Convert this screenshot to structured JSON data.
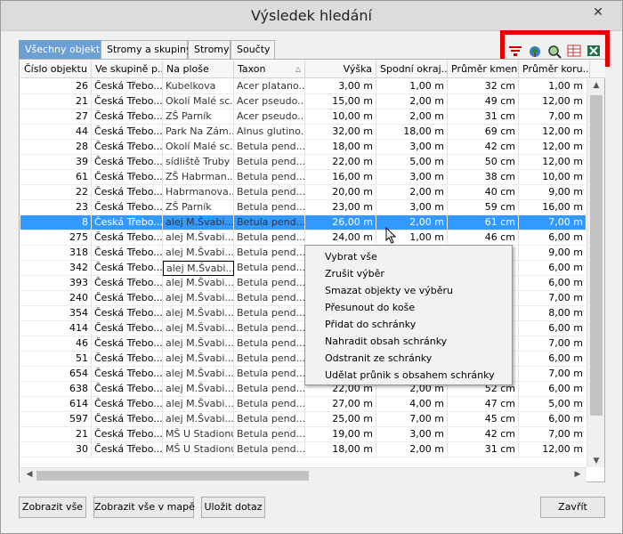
{
  "window": {
    "title": "Výsledek hledání",
    "close_label": "✕"
  },
  "tabs": [
    {
      "label": "Všechny objekty",
      "active": true
    },
    {
      "label": "Stromy a skupiny"
    },
    {
      "label": "Stromy"
    },
    {
      "label": "Součty"
    }
  ],
  "toolbar": {
    "icons": [
      "filter-icon",
      "map-tree-icon",
      "zoom-map-icon",
      "table-icon",
      "excel-icon"
    ],
    "accent_frame_color": "#e60000"
  },
  "columns": [
    "Číslo objektu",
    "Ve skupině p...",
    "Na ploše",
    "Taxon",
    "Výška",
    "Spodní okraj...",
    "Průměr kmene",
    "Průměr koru..."
  ],
  "rows": [
    [
      "26",
      "Česká Třebo...",
      "Kubelkova",
      "Acer platano...",
      "3,00 m",
      "1,00 m",
      "32 cm",
      "1,00 m"
    ],
    [
      "21",
      "Česká Třebo...",
      "Okolí Malé sc...",
      "Acer pseudo...",
      "15,00 m",
      "2,00 m",
      "49 cm",
      "12,00 m"
    ],
    [
      "27",
      "Česká Třebo...",
      "ZŠ Parník",
      "Acer pseudo...",
      "10,00 m",
      "2,00 m",
      "31 cm",
      "7,00 m"
    ],
    [
      "44",
      "Česká Třebo...",
      "Park Na Zám...",
      "Alnus glutino...",
      "32,00 m",
      "18,00 m",
      "69 cm",
      "12,00 m"
    ],
    [
      "28",
      "Česká Třebo...",
      "Okolí Malé sc...",
      "Betula pend...",
      "18,00 m",
      "3,00 m",
      "42 cm",
      "12,00 m"
    ],
    [
      "39",
      "Česká Třebo...",
      "sídliště Truby",
      "Betula pend...",
      "22,00 m",
      "5,00 m",
      "50 cm",
      "12,00 m"
    ],
    [
      "61",
      "Česká Třebo...",
      "ZŠ Habrman...",
      "Betula pend...",
      "16,00 m",
      "3,00 m",
      "38 cm",
      "10,00 m"
    ],
    [
      "22",
      "Česká Třebo...",
      "Habrmanova...",
      "Betula pend...",
      "20,00 m",
      "2,00 m",
      "40 cm",
      "9,00 m"
    ],
    [
      "23",
      "Česká Třebo...",
      "ZŠ Parník",
      "Betula pend...",
      "23,00 m",
      "3,00 m",
      "59 cm",
      "16,00 m"
    ],
    [
      "8",
      "Česká Třebo...",
      "alej M.Švabi...",
      "Betula pend...",
      "26,00 m",
      "2,00 m",
      "61 cm",
      "7,00 m"
    ],
    [
      "275",
      "Česká Třebo...",
      "alej M.Švabi...",
      "Betula pend...",
      "24,00 m",
      "1,00 m",
      "46 cm",
      "6,00 m"
    ],
    [
      "318",
      "Česká Třebo...",
      "alej M.Švabi...",
      "Betula pend...",
      "",
      "",
      "",
      "9,00 m"
    ],
    [
      "342",
      "Česká Třebo...",
      "alej M.Švabi...",
      "Betula pend...",
      "",
      "",
      "",
      "6,00 m"
    ],
    [
      "393",
      "Česká Třebo...",
      "alej M.Švabi...",
      "Betula pend...",
      "",
      "",
      "",
      "6,00 m"
    ],
    [
      "240",
      "Česká Třebo...",
      "alej M.Švabi...",
      "Betula pend...",
      "",
      "",
      "",
      "7,00 m"
    ],
    [
      "354",
      "Česká Třebo...",
      "alej M.Švabi...",
      "Betula pend...",
      "",
      "",
      "",
      "8,00 m"
    ],
    [
      "414",
      "Česká Třebo...",
      "alej M.Švabi...",
      "Betula pend...",
      "",
      "",
      "",
      "6,00 m"
    ],
    [
      "46",
      "Česká Třebo...",
      "alej M.Švabi...",
      "Betula pend...",
      "",
      "",
      "",
      "7,00 m"
    ],
    [
      "51",
      "Česká Třebo...",
      "alej M.Švabi...",
      "Betula pend...",
      "",
      "",
      "",
      "6,00 m"
    ],
    [
      "654",
      "Česká Třebo...",
      "alej M.Švabi...",
      "Betula pend...",
      "",
      "",
      "",
      "7,00 m"
    ],
    [
      "638",
      "Česká Třebo...",
      "alej M.Švabi...",
      "Betula pend...",
      "22,00 m",
      "2,00 m",
      "52 cm",
      "6,00 m"
    ],
    [
      "614",
      "Česká Třebo...",
      "alej M.Švabi...",
      "Betula pend...",
      "27,00 m",
      "4,00 m",
      "47 cm",
      "5,00 m"
    ],
    [
      "597",
      "Česká Třebo...",
      "alej M.Švabi...",
      "Betula pend...",
      "25,00 m",
      "7,00 m",
      "45 cm",
      "6,00 m"
    ],
    [
      "21",
      "Česká Třebo...",
      "MŠ U Stadionu",
      "Betula pend...",
      "19,00 m",
      "3,00 m",
      "42 cm",
      "7,00 m"
    ],
    [
      "30",
      "Česká Třebo...",
      "MŠ U Stadionu",
      "Betula pend...",
      "18,00 m",
      "2,00 m",
      "31 cm",
      "12,00 m"
    ]
  ],
  "selected_row_index": 9,
  "context_menu": [
    "Vybrat vše",
    "Zrušit výběr",
    "Smazat objekty ve výběru",
    "Přesunout do koše",
    "Přidat do schránky",
    "Nahradit obsah schránky",
    "Odstranit ze schránky",
    "Udělat průnik s obsahem schránky"
  ],
  "buttons": {
    "show_all": "Zobrazit vše",
    "show_all_map": "Zobrazit vše v mapě",
    "save_query": "Uložit dotaz",
    "close": "Zavřít"
  },
  "colors": {
    "selection": "#3399ff",
    "active_tab": "#6c9fd4"
  }
}
